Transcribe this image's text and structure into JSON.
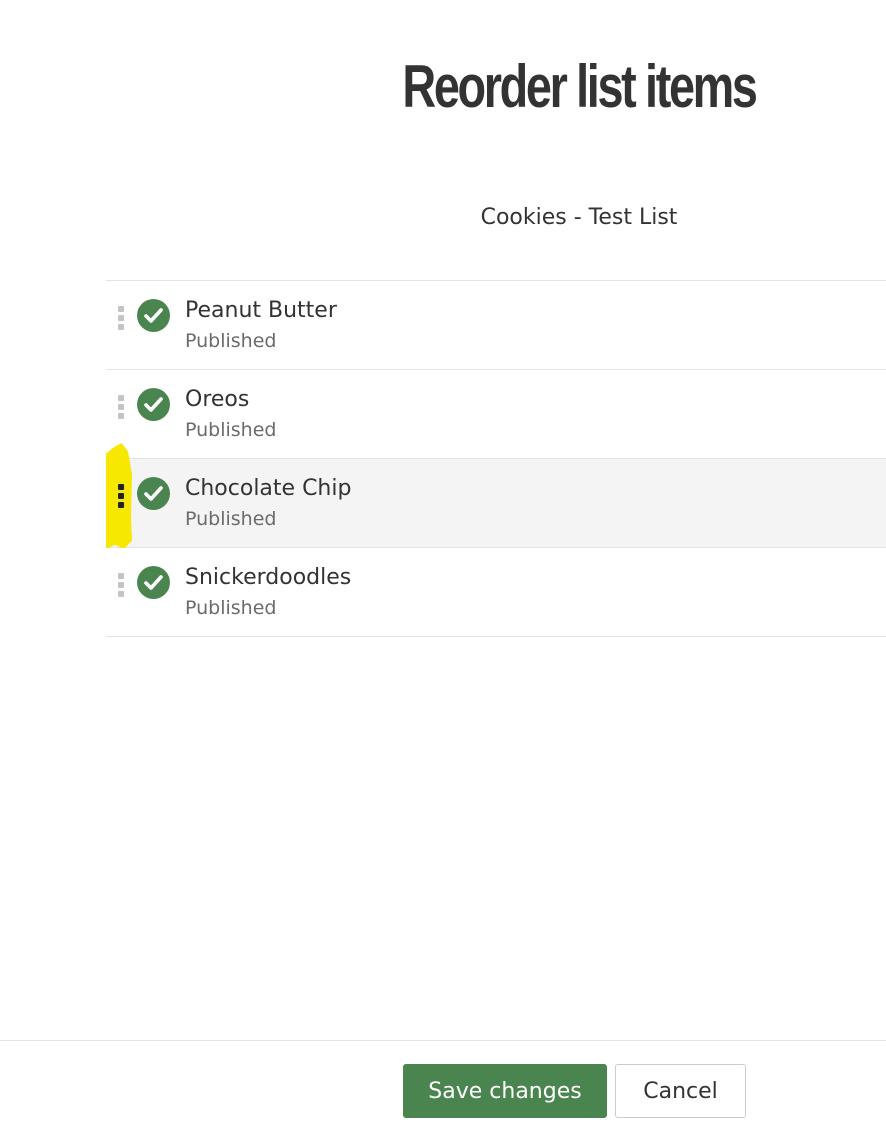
{
  "page": {
    "title": "Reorder list items",
    "list_name": "Cookies - Test List"
  },
  "items": [
    {
      "title": "Peanut Butter",
      "status": "Published"
    },
    {
      "title": "Oreos",
      "status": "Published"
    },
    {
      "title": "Chocolate Chip",
      "status": "Published",
      "active": true
    },
    {
      "title": "Snickerdoodles",
      "status": "Published"
    }
  ],
  "icons": {
    "status": "check-circle-icon",
    "handle": "drag-handle-icon"
  },
  "footer": {
    "save_label": "Save changes",
    "cancel_label": "Cancel"
  },
  "colors": {
    "accent": "#4a8550",
    "highlight": "#f6e800",
    "text": "#333333",
    "muted": "#6b6b6b"
  }
}
